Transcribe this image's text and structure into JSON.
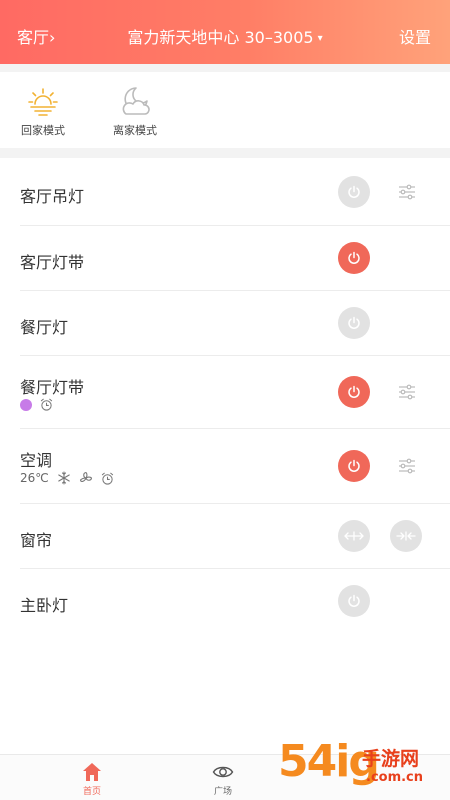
{
  "header": {
    "room": "客厅",
    "room_chevron": "›",
    "title": "富力新天地中心 30–3005",
    "title_caret": "▾",
    "settings": "设置"
  },
  "modes": [
    {
      "label": "回家模式",
      "icon": "sunrise-icon",
      "color": "#f2b233"
    },
    {
      "label": "离家模式",
      "icon": "moon-cloud-icon",
      "color": "#bbbbbb"
    }
  ],
  "devices": [
    {
      "name": "客厅吊灯",
      "power": "off",
      "adjust": true
    },
    {
      "name": "客厅灯带",
      "power": "on",
      "adjust": false
    },
    {
      "name": "餐厅灯",
      "power": "off",
      "adjust": false
    },
    {
      "name": "餐厅灯带",
      "power": "on",
      "adjust": true,
      "color_dot": "#c77be8",
      "timer": true
    },
    {
      "name": "空调",
      "power": "on",
      "adjust": true,
      "temperature": "26℃",
      "icons": [
        "snowflake-icon",
        "fan-icon",
        "alarm-clock-icon"
      ]
    },
    {
      "name": "窗帘",
      "controls": [
        "curtain-open-icon",
        "curtain-close-icon"
      ]
    },
    {
      "name": "主卧灯",
      "power": "off",
      "adjust": false
    }
  ],
  "tabs": [
    {
      "label": "首页",
      "icon": "home-icon",
      "active": true
    },
    {
      "label": "广场",
      "icon": "eye-icon",
      "active": false
    }
  ],
  "watermark": {
    "big": "54ig",
    "cn": "手游网",
    "url": ".com.cn"
  },
  "colors": {
    "accent": "#f06859",
    "power_off": "#e2e2e2"
  }
}
